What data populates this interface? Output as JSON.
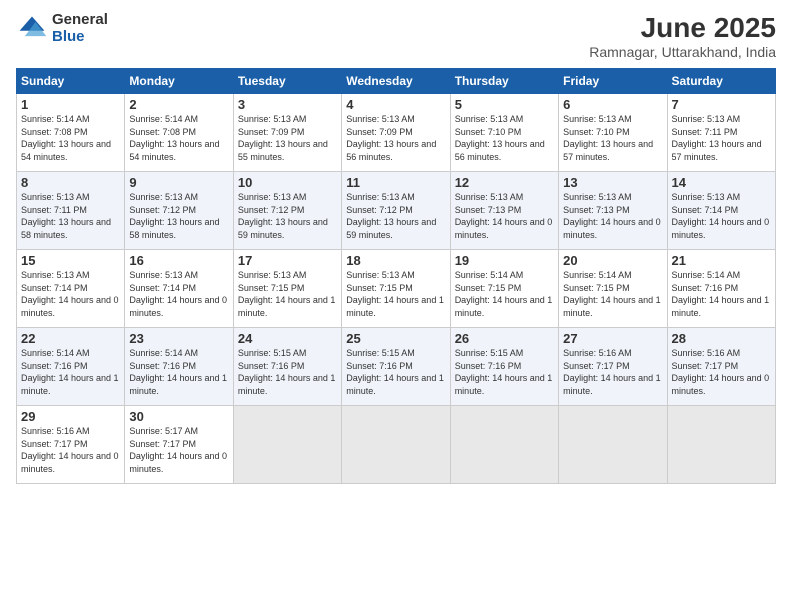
{
  "logo": {
    "general": "General",
    "blue": "Blue"
  },
  "header": {
    "month_year": "June 2025",
    "location": "Ramnagar, Uttarakhand, India"
  },
  "weekdays": [
    "Sunday",
    "Monday",
    "Tuesday",
    "Wednesday",
    "Thursday",
    "Friday",
    "Saturday"
  ],
  "weeks": [
    [
      {
        "day": "1",
        "sunrise": "5:14 AM",
        "sunset": "7:08 PM",
        "daylight": "13 hours and 54 minutes."
      },
      {
        "day": "2",
        "sunrise": "5:14 AM",
        "sunset": "7:08 PM",
        "daylight": "13 hours and 54 minutes."
      },
      {
        "day": "3",
        "sunrise": "5:13 AM",
        "sunset": "7:09 PM",
        "daylight": "13 hours and 55 minutes."
      },
      {
        "day": "4",
        "sunrise": "5:13 AM",
        "sunset": "7:09 PM",
        "daylight": "13 hours and 56 minutes."
      },
      {
        "day": "5",
        "sunrise": "5:13 AM",
        "sunset": "7:10 PM",
        "daylight": "13 hours and 56 minutes."
      },
      {
        "day": "6",
        "sunrise": "5:13 AM",
        "sunset": "7:10 PM",
        "daylight": "13 hours and 57 minutes."
      },
      {
        "day": "7",
        "sunrise": "5:13 AM",
        "sunset": "7:11 PM",
        "daylight": "13 hours and 57 minutes."
      }
    ],
    [
      {
        "day": "8",
        "sunrise": "5:13 AM",
        "sunset": "7:11 PM",
        "daylight": "13 hours and 58 minutes."
      },
      {
        "day": "9",
        "sunrise": "5:13 AM",
        "sunset": "7:12 PM",
        "daylight": "13 hours and 58 minutes."
      },
      {
        "day": "10",
        "sunrise": "5:13 AM",
        "sunset": "7:12 PM",
        "daylight": "13 hours and 59 minutes."
      },
      {
        "day": "11",
        "sunrise": "5:13 AM",
        "sunset": "7:12 PM",
        "daylight": "13 hours and 59 minutes."
      },
      {
        "day": "12",
        "sunrise": "5:13 AM",
        "sunset": "7:13 PM",
        "daylight": "14 hours and 0 minutes."
      },
      {
        "day": "13",
        "sunrise": "5:13 AM",
        "sunset": "7:13 PM",
        "daylight": "14 hours and 0 minutes."
      },
      {
        "day": "14",
        "sunrise": "5:13 AM",
        "sunset": "7:14 PM",
        "daylight": "14 hours and 0 minutes."
      }
    ],
    [
      {
        "day": "15",
        "sunrise": "5:13 AM",
        "sunset": "7:14 PM",
        "daylight": "14 hours and 0 minutes."
      },
      {
        "day": "16",
        "sunrise": "5:13 AM",
        "sunset": "7:14 PM",
        "daylight": "14 hours and 0 minutes."
      },
      {
        "day": "17",
        "sunrise": "5:13 AM",
        "sunset": "7:15 PM",
        "daylight": "14 hours and 1 minute."
      },
      {
        "day": "18",
        "sunrise": "5:13 AM",
        "sunset": "7:15 PM",
        "daylight": "14 hours and 1 minute."
      },
      {
        "day": "19",
        "sunrise": "5:14 AM",
        "sunset": "7:15 PM",
        "daylight": "14 hours and 1 minute."
      },
      {
        "day": "20",
        "sunrise": "5:14 AM",
        "sunset": "7:15 PM",
        "daylight": "14 hours and 1 minute."
      },
      {
        "day": "21",
        "sunrise": "5:14 AM",
        "sunset": "7:16 PM",
        "daylight": "14 hours and 1 minute."
      }
    ],
    [
      {
        "day": "22",
        "sunrise": "5:14 AM",
        "sunset": "7:16 PM",
        "daylight": "14 hours and 1 minute."
      },
      {
        "day": "23",
        "sunrise": "5:14 AM",
        "sunset": "7:16 PM",
        "daylight": "14 hours and 1 minute."
      },
      {
        "day": "24",
        "sunrise": "5:15 AM",
        "sunset": "7:16 PM",
        "daylight": "14 hours and 1 minute."
      },
      {
        "day": "25",
        "sunrise": "5:15 AM",
        "sunset": "7:16 PM",
        "daylight": "14 hours and 1 minute."
      },
      {
        "day": "26",
        "sunrise": "5:15 AM",
        "sunset": "7:16 PM",
        "daylight": "14 hours and 1 minute."
      },
      {
        "day": "27",
        "sunrise": "5:16 AM",
        "sunset": "7:17 PM",
        "daylight": "14 hours and 1 minute."
      },
      {
        "day": "28",
        "sunrise": "5:16 AM",
        "sunset": "7:17 PM",
        "daylight": "14 hours and 0 minutes."
      }
    ],
    [
      {
        "day": "29",
        "sunrise": "5:16 AM",
        "sunset": "7:17 PM",
        "daylight": "14 hours and 0 minutes."
      },
      {
        "day": "30",
        "sunrise": "5:17 AM",
        "sunset": "7:17 PM",
        "daylight": "14 hours and 0 minutes."
      },
      null,
      null,
      null,
      null,
      null
    ]
  ],
  "labels": {
    "sunrise": "Sunrise:",
    "sunset": "Sunset:",
    "daylight": "Daylight:"
  }
}
